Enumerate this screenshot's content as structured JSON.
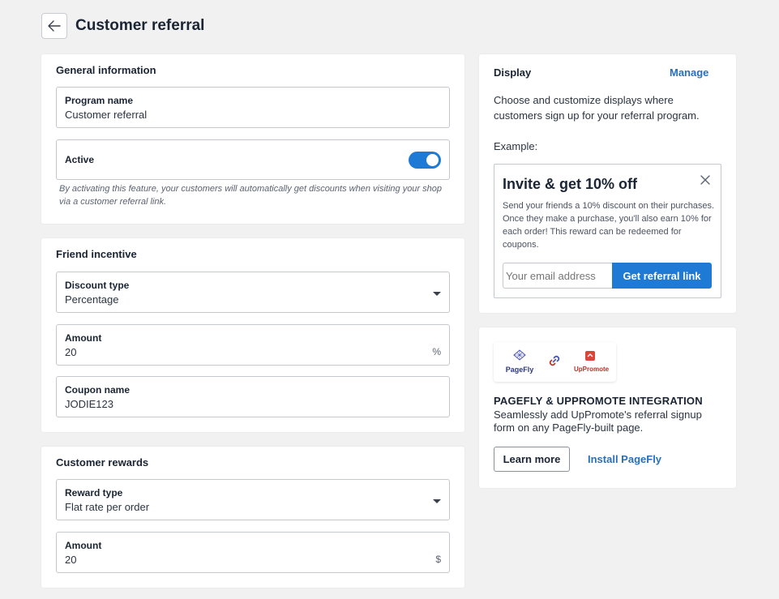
{
  "header": {
    "title": "Customer referral"
  },
  "general": {
    "title": "General information",
    "program_name_label": "Program name",
    "program_name_value": "Customer referral",
    "active_label": "Active",
    "active_help": "By activating this feature, your customers will automatically get discounts when visiting your shop via a customer referral link."
  },
  "friend": {
    "title": "Friend incentive",
    "discount_type_label": "Discount type",
    "discount_type_value": "Percentage",
    "amount_label": "Amount",
    "amount_value": "20",
    "amount_suffix": "%",
    "coupon_label": "Coupon name",
    "coupon_value": "JODIE123"
  },
  "rewards": {
    "title": "Customer rewards",
    "reward_type_label": "Reward type",
    "reward_type_value": "Flat rate per order",
    "amount_label": "Amount",
    "amount_value": "20",
    "amount_suffix": "$"
  },
  "display": {
    "title": "Display",
    "manage_link": "Manage",
    "description": "Choose and customize displays where customers sign up for your referral program.",
    "example_label": "Example:",
    "example": {
      "title": "Invite & get 10% off",
      "body": "Send your friends a 10% discount on their purchases. Once they make a purchase, you'll also earn 10% for each order! This reward can be redeemed for coupons.",
      "email_placeholder": "Your email address",
      "button": "Get referral link"
    }
  },
  "integration": {
    "pagefly_logo_text": "PageFly",
    "uppromote_logo_text": "UpPromote",
    "title": "PAGEFLY & UPPROMOTE INTEGRATION",
    "description": "Seamlessly add UpPromote's referral signup form on any PageFly-built page.",
    "learn_more": "Learn more",
    "install": "Install PageFly"
  },
  "colors": {
    "accent": "#1f7ad6",
    "link": "#2a6fb8",
    "background": "#f1f1f1"
  }
}
